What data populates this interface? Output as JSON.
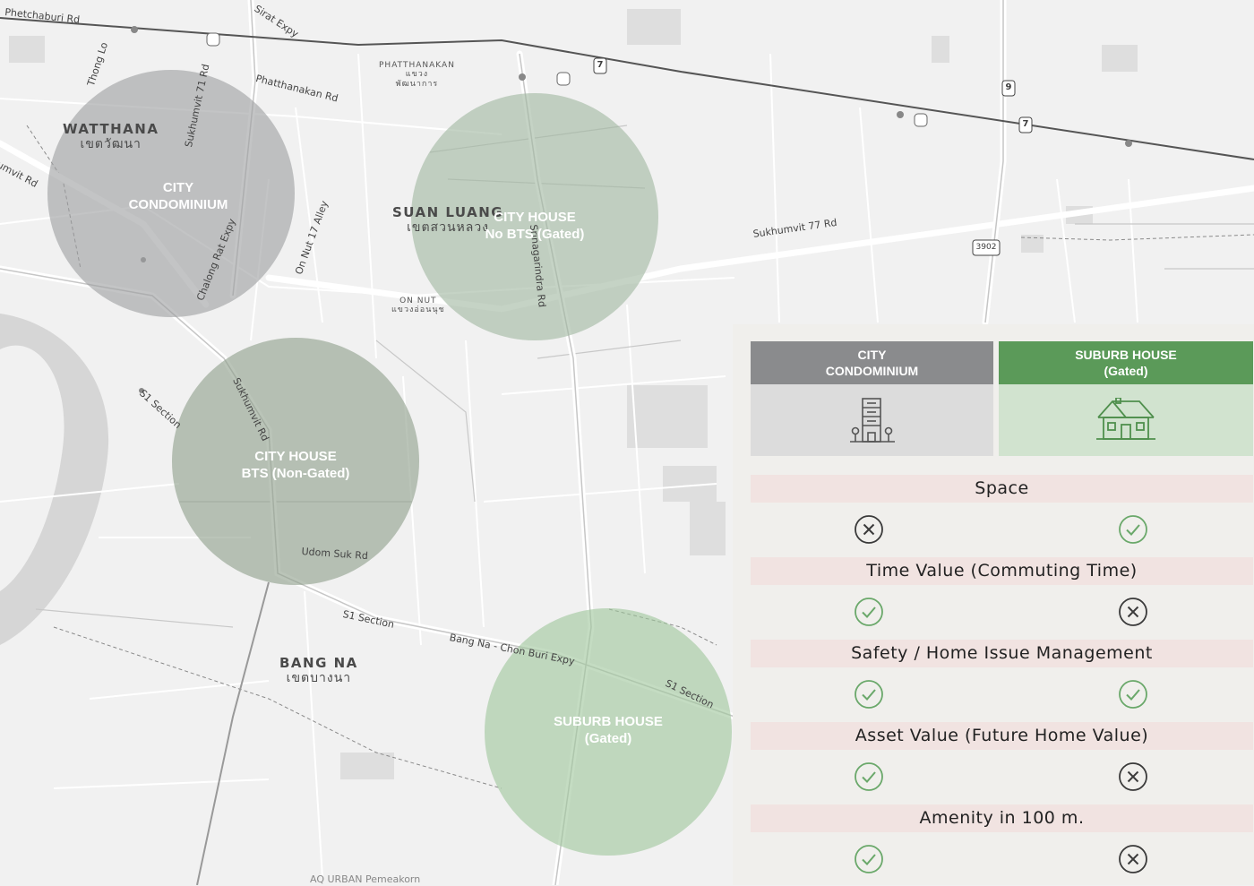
{
  "map": {
    "districts": [
      {
        "name": "WATTHANA",
        "thai": "เขตวัฒนา"
      },
      {
        "name": "SUAN LUANG",
        "thai": "เขตสวนหลวง"
      },
      {
        "name": "BANG NA",
        "thai": "เขตบางนา"
      }
    ],
    "subdistricts": [
      {
        "name": "PHATTHANAKAN",
        "thai1": "แขวง",
        "thai2": "พัฒนาการ"
      },
      {
        "name": "ON NUT",
        "thai1": "แขวงอ่อนนุช"
      }
    ],
    "roads": {
      "phetchaburi": "Phetchaburi Rd",
      "sirat": "Sirat Expy",
      "thonglo": "Thong Lo",
      "sukhumvit71": "Sukhumvit 71 Rd",
      "phatthanakan": "Phatthanakan Rd",
      "sukhumvit_left": "umvit Rd",
      "chalong": "Chalong Rat Expy",
      "onnut17": "On Nut 17 Alley",
      "srinagarindra": "Srinagarindra Rd",
      "sukhumvit77": "Sukhumvit 77 Rd",
      "s1_a": "S1 Section",
      "sukhumvit_mid": "Sukhumvit Rd",
      "udomsuk": "Udom Suk Rd",
      "s1_b": "S1 Section",
      "bangna_expy": "Bang Na - Chon Buri Expy",
      "s1_c": "S1 Section",
      "bottom": "AQ URBAN Pemeakorn"
    },
    "shields": {
      "route7": "7",
      "route9": "9",
      "route3902": "3902"
    },
    "circles": [
      {
        "line1": "CITY",
        "line2": "CONDOMINIUM",
        "color": "#9e9fa1"
      },
      {
        "line1": "CITY HOUSE",
        "line2": "No BTS (Gated)",
        "color": "#a2b8a1"
      },
      {
        "line1": "CITY HOUSE",
        "line2": "BTS (Non-Gated)",
        "color": "#8fa08d"
      },
      {
        "line1": "SUBURB HOUSE",
        "line2": "(Gated)",
        "color": "#9fc79c"
      }
    ]
  },
  "comparison": {
    "columns": [
      {
        "line1": "CITY",
        "line2": "CONDOMINIUM",
        "header_color": "#8a8b8d",
        "icon": "building-icon"
      },
      {
        "line1": "SUBURB HOUSE",
        "line2": "(Gated)",
        "header_color": "#5b9a59",
        "icon": "house-icon"
      }
    ],
    "criteria": [
      {
        "label": "Space",
        "condo": "cross",
        "suburb": "check"
      },
      {
        "label": "Time Value (Commuting Time)",
        "condo": "check",
        "suburb": "cross"
      },
      {
        "label": "Safety / Home Issue Management",
        "condo": "check",
        "suburb": "check"
      },
      {
        "label": "Asset Value (Future Home Value)",
        "condo": "check",
        "suburb": "cross"
      },
      {
        "label": "Amenity in 100 m.",
        "condo": "check",
        "suburb": "cross"
      }
    ],
    "colors": {
      "check": "#6aa86a",
      "cross": "#3a3a3a",
      "criterion_bg": "#f1e3e1"
    }
  }
}
